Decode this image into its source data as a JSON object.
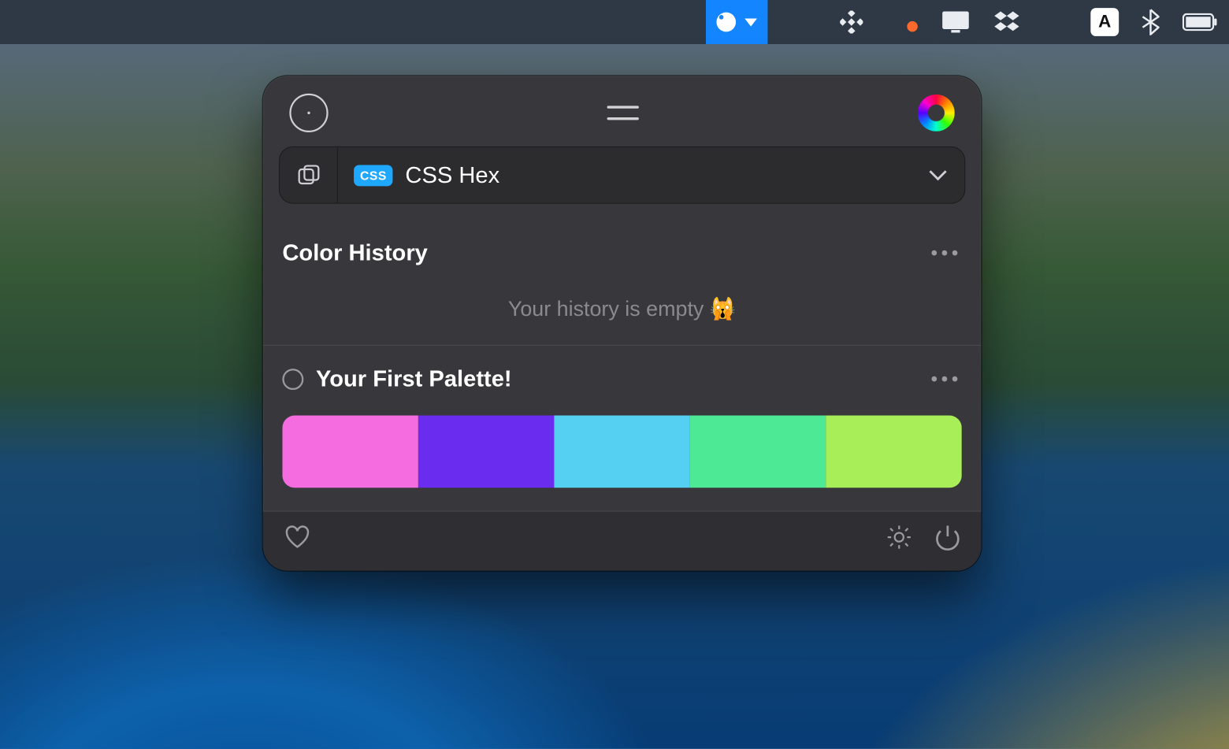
{
  "menubar": {
    "items": [
      {
        "name": "sip-menu",
        "active": true
      },
      {
        "name": "cast-icon"
      },
      {
        "name": "setapp-icon"
      },
      {
        "name": "cloud-icon"
      },
      {
        "name": "screen-icon"
      },
      {
        "name": "dropbox-icon"
      },
      {
        "name": "search-icon"
      },
      {
        "name": "input-a-icon",
        "label": "A"
      },
      {
        "name": "bluetooth-icon"
      },
      {
        "name": "battery-icon"
      }
    ]
  },
  "popover": {
    "format": {
      "badge": "CSS",
      "label": "CSS Hex"
    },
    "history": {
      "title": "Color History",
      "empty_message": "Your history is empty 🙀"
    },
    "palette": {
      "title": "Your First Palette!",
      "colors": [
        "#f56ce0",
        "#6a2df0",
        "#55d0f2",
        "#4ee995",
        "#a7ee58"
      ]
    }
  }
}
